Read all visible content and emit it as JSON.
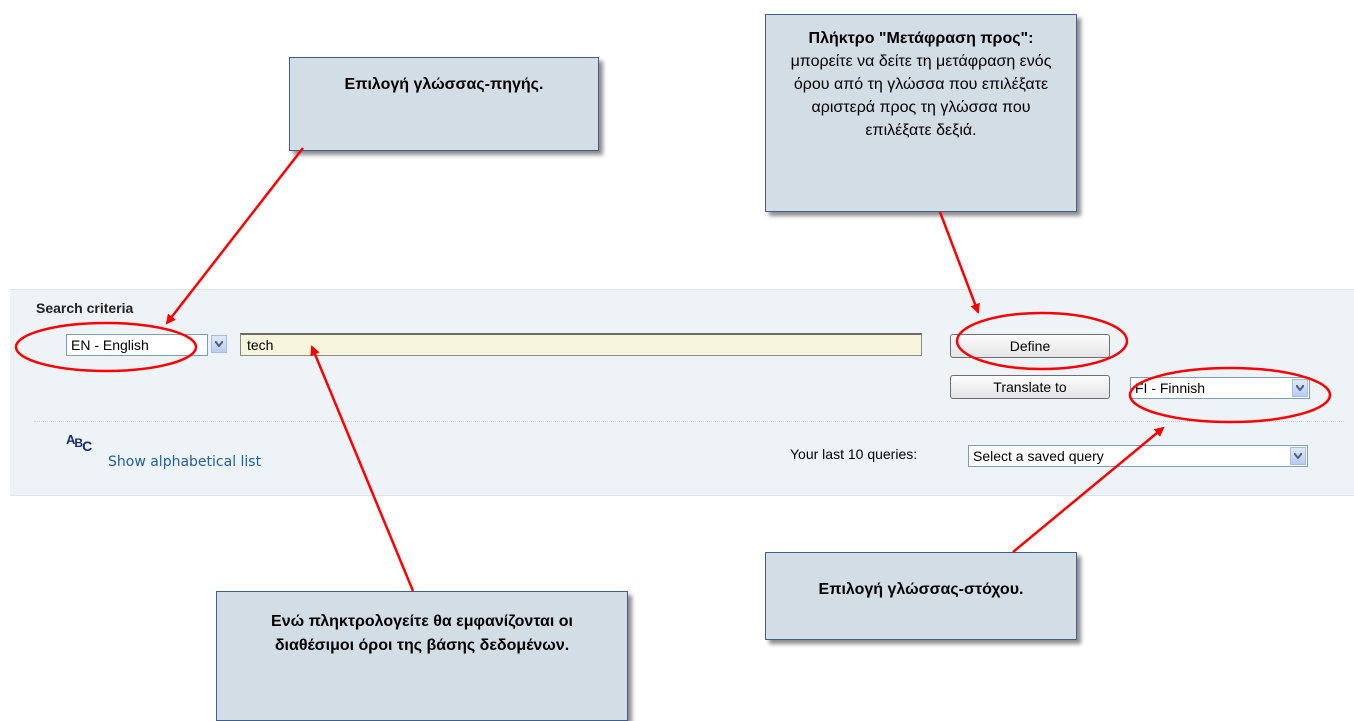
{
  "search_panel": {
    "title": "Search criteria",
    "source_language": "EN - English",
    "search_value": "tech",
    "define_button": "Define",
    "translate_button": "Translate to",
    "target_language": "FI - Finnish",
    "alphabetical_link": "Show alphabetical list",
    "abc_icon": {
      "a": "A",
      "b": "B",
      "c": "C"
    },
    "last_queries_label": "Your last 10 queries:",
    "saved_query": "Select a saved query"
  },
  "callouts": {
    "source_language": "Επιλογή γλώσσας-πηγής.",
    "translate_title": "Πλήκτρο \"Μετάφραση προς\":",
    "translate_body": "μπορείτε να δείτε τη μετάφραση ενός όρου από τη γλώσσα που επιλέξατε αριστερά προς τη γλώσσα που επιλέξατε δεξιά.",
    "target_language": "Επιλογή γλώσσας-στόχου.",
    "typing_hint": "Ενώ πληκτρολογείτε θα εμφανίζονται οι διαθέσιμοι όροι της βάσης δεδομένων."
  },
  "colors": {
    "annotation": "#ff0000",
    "panel_background": "#eef3f7",
    "callout_background": "#d3dde6",
    "link": "#1f5fa8"
  }
}
